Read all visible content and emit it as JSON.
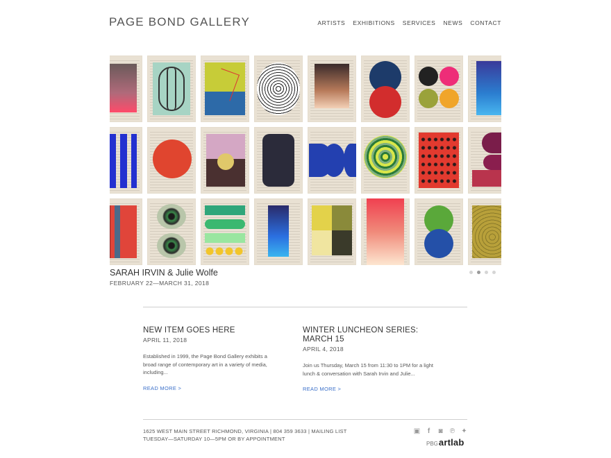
{
  "header": {
    "logo": "PAGE BOND GALLERY",
    "nav": [
      "ARTISTS",
      "EXHIBITIONS",
      "SERVICES",
      "NEWS",
      "CONTACT"
    ]
  },
  "slider": {
    "artworks": [
      "gradient-pink",
      "loops",
      "constellation",
      "spiral",
      "gradient-brown",
      "circles-navy-red",
      "four-dots",
      "gradient-blue",
      "blue-blocks",
      "red-circle",
      "pink-arch",
      "dark-capsule",
      "blue-half-circles",
      "green-rings",
      "red-dots-grid",
      "maroon-blobs",
      "red-stripes",
      "eye-shapes",
      "green-bands",
      "blue-gradient",
      "yellow-olive-squares",
      "red-gradient",
      "green-blue-circles",
      "olive-swirls"
    ],
    "caption": {
      "artists": "SARAH IRVIN & Julie Wolfe",
      "dates": "FEBRUARY 22—MARCH 31, 2018"
    },
    "dots": [
      {
        "active": false
      },
      {
        "active": true
      },
      {
        "active": false
      },
      {
        "active": false
      }
    ]
  },
  "news": [
    {
      "title": "NEW ITEM GOES HERE",
      "date": "APRIL 11, 2018",
      "excerpt": "Established in 1999, the Page Bond Gallery exhibits a broad range of contemporary art in a variety of media, including...",
      "more": "READ MORE >"
    },
    {
      "title": "WINTER LUNCHEON SERIES: MARCH 15",
      "date": "APRIL 4, 2018",
      "excerpt": "Join us Thursday, March 15 from 11:30 to 1PM for a light lunch & conversation with Sarah Irvin and Julie...",
      "more": "READ MORE >"
    }
  ],
  "footer": {
    "address": "1625 WEST MAIN STREET RICHMOND, VIRGINIA | 804 359 3633 | MAILING LIST",
    "hours": "TUESDAY—SATURDAY 10—5PM OR BY APPOINTMENT",
    "social": [
      "artsy-icon",
      "facebook-icon",
      "instagram-icon",
      "pinterest-icon",
      "twitter-icon"
    ],
    "brand_prefix": "PBG",
    "brand_name": "artlab"
  }
}
